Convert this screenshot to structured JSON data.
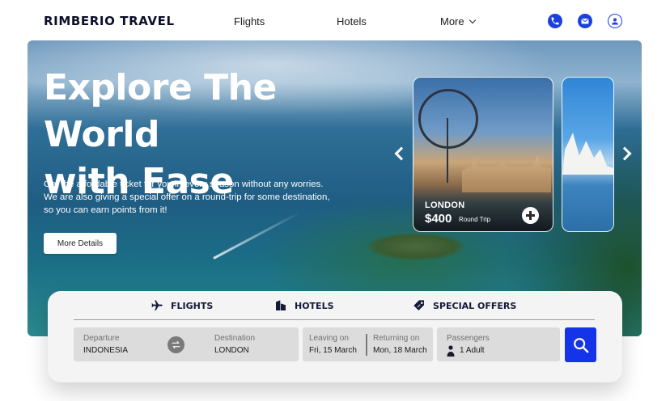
{
  "nav": {
    "logo": "RIMBERIO TRAVEL",
    "links": {
      "flights": "Flights",
      "hotels": "Hotels",
      "more": "More"
    },
    "icons": [
      "phone-icon",
      "mail-icon",
      "user-icon"
    ]
  },
  "hero": {
    "title_line1": "Explore The World",
    "title_line2": "with Ease",
    "subtitle_line1": "Get the affordable ticket for you in every season without any worries.",
    "subtitle_line2": "We are also giving a special offer on a round-trip for some destination,",
    "subtitle_line3": "so you can earn points from it!",
    "cta": "More Details"
  },
  "destinations": [
    {
      "city": "LONDON",
      "price": "$400",
      "trip": "Round Trip"
    }
  ],
  "search": {
    "tabs": {
      "flights": "FLIGHTS",
      "hotels": "HOTELS",
      "offers": "SPECIAL OFFERS"
    },
    "departure": {
      "label": "Departure",
      "value": "INDONESIA"
    },
    "destination": {
      "label": "Destination",
      "value": "LONDON"
    },
    "leaving": {
      "label": "Leaving on",
      "value": "Fri, 15 March"
    },
    "returning": {
      "label": "Returning on",
      "value": "Mon, 18 March"
    },
    "passengers": {
      "label": "Passengers",
      "value": "1 Adult"
    }
  },
  "colors": {
    "accent": "#1533e8",
    "brand_text": "#0b0f2a",
    "panel_bg": "#f4f4f4"
  }
}
